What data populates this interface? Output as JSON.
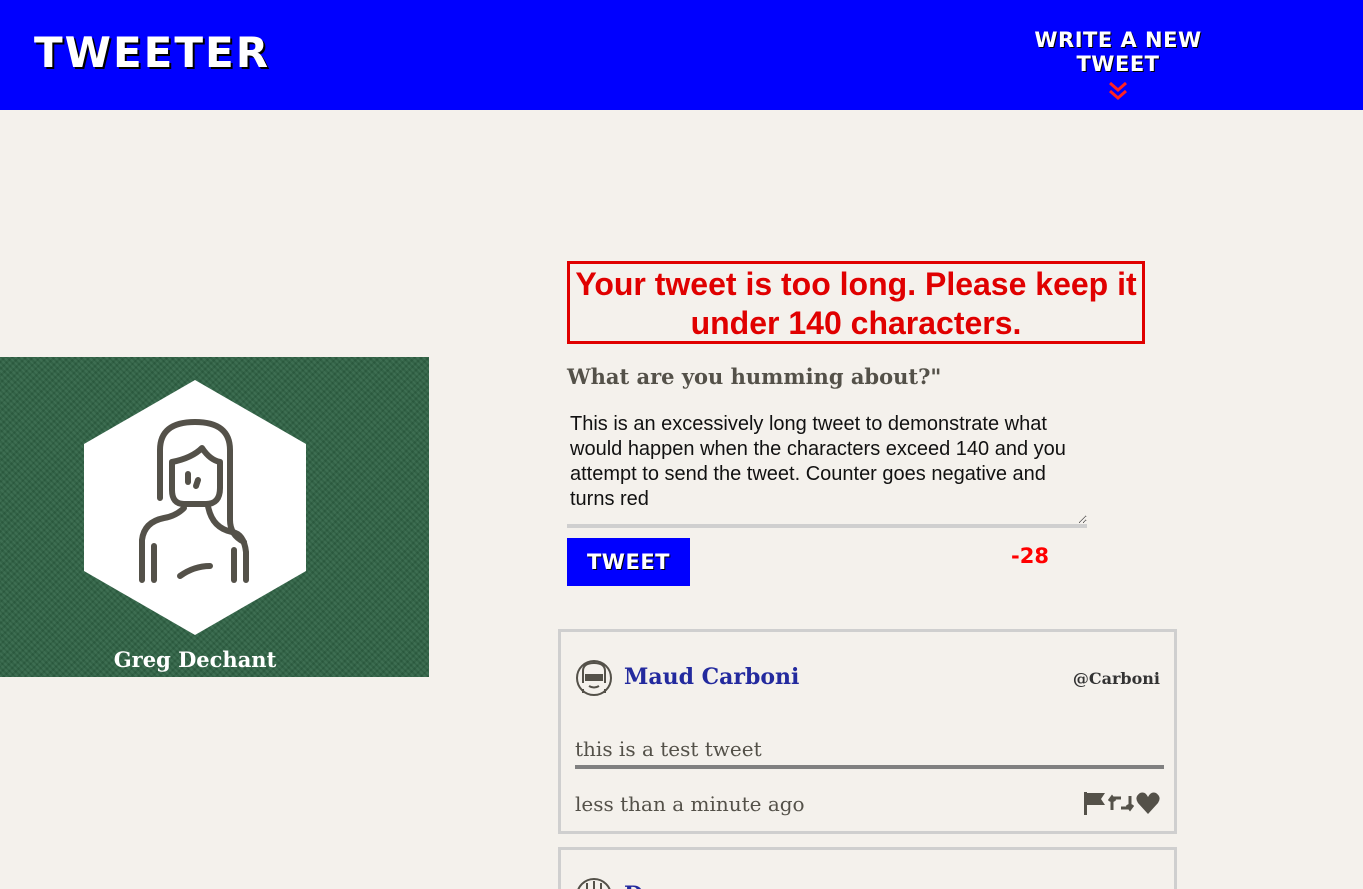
{
  "nav": {
    "brand": "TWEETER",
    "compose_link": "WRITE A NEW TWEET",
    "compose_icon": "double-chevron-down-icon",
    "accent_color": "#0000ff",
    "chevron_color": "#ff2222"
  },
  "profile": {
    "name": "Greg Dechant",
    "avatar_icon": "person-avatar-icon",
    "background_color": "#2f6345"
  },
  "compose": {
    "error": "Your tweet is too long. Please keep it under 140 characters.",
    "heading": "What are you humming about?\"",
    "text": "This is an excessively long tweet to demonstrate what would happen when the characters exceed 140 and you attempt to send the tweet. Counter goes negative and turns red",
    "submit_label": "TWEET",
    "counter": "-28",
    "error_color": "#e00000"
  },
  "tweets": [
    {
      "name": "Maud Carboni",
      "handle": "@Carboni",
      "content": "this is a test tweet",
      "time": "less than a minute ago",
      "actions": [
        "flag-icon",
        "retweet-icon",
        "heart-icon"
      ]
    },
    {
      "name": "D"
    }
  ]
}
